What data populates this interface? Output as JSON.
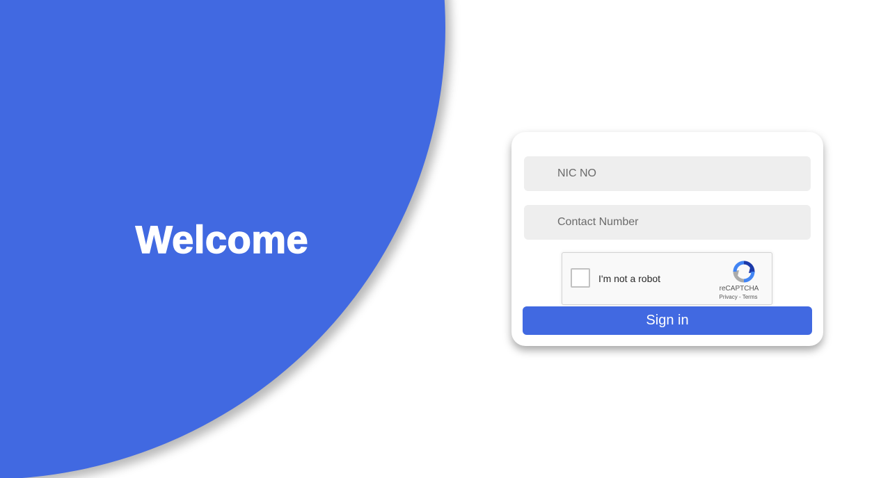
{
  "hero": {
    "title": "Welcome"
  },
  "login_form": {
    "nic": {
      "placeholder": "NIC NO",
      "value": ""
    },
    "contact": {
      "placeholder": "Contact Number",
      "value": ""
    },
    "captcha": {
      "label": "I'm not a robot",
      "brand": "reCAPTCHA",
      "privacy_label": "Privacy",
      "separator": " - ",
      "terms_label": "Terms",
      "checked": false,
      "icon": "recaptcha-logo-icon"
    },
    "submit_label": "Sign in"
  },
  "colors": {
    "accent": "#4169e1",
    "field_background": "#eeeeee",
    "background": "#ffffff"
  }
}
